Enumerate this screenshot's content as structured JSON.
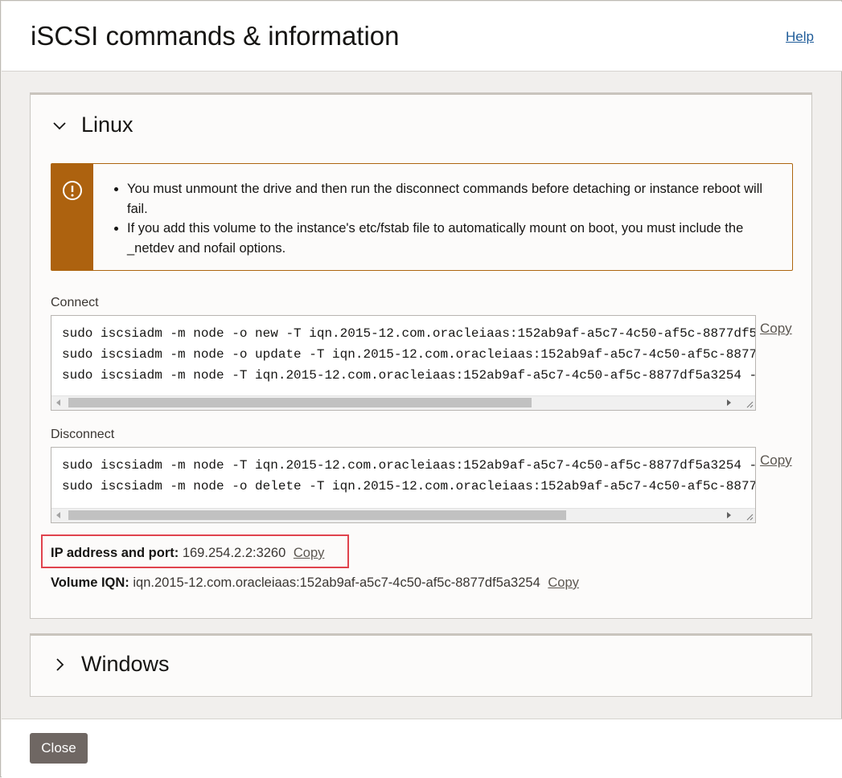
{
  "dialog": {
    "title": "iSCSI commands & information",
    "help_label": "Help"
  },
  "linux": {
    "section_title": "Linux",
    "warning_items": [
      "You must unmount the drive and then run the disconnect commands before detaching or instance reboot will fail.",
      "If you add this volume to the instance's etc/fstab file to automatically mount on boot, you must include the _netdev and nofail options."
    ],
    "connect_label": "Connect",
    "connect_commands": [
      "sudo iscsiadm -m node -o new -T iqn.2015-12.com.oracleiaas:152ab9af-a5c7-4c50-af5c-8877df5",
      "sudo iscsiadm -m node -o update -T iqn.2015-12.com.oracleiaas:152ab9af-a5c7-4c50-af5c-8877",
      "sudo iscsiadm -m node -T iqn.2015-12.com.oracleiaas:152ab9af-a5c7-4c50-af5c-8877df5a3254 -"
    ],
    "disconnect_label": "Disconnect",
    "disconnect_commands": [
      "sudo iscsiadm -m node -T iqn.2015-12.com.oracleiaas:152ab9af-a5c7-4c50-af5c-8877df5a3254 -",
      "sudo iscsiadm -m node -o delete -T iqn.2015-12.com.oracleiaas:152ab9af-a5c7-4c50-af5c-8877"
    ],
    "copy_label": "Copy",
    "ip_label": "IP address and port:",
    "ip_value": "169.254.2.2:3260",
    "iqn_label": "Volume IQN:",
    "iqn_value": "iqn.2015-12.com.oracleiaas:152ab9af-a5c7-4c50-af5c-8877df5a3254"
  },
  "windows": {
    "section_title": "Windows"
  },
  "footer": {
    "close_label": "Close"
  },
  "icons": {
    "warning": "exclamation-circle-icon",
    "expanded": "chevron-down-icon",
    "collapsed": "chevron-right-icon"
  },
  "colors": {
    "warning": "#ad620f",
    "highlight": "#e0434d",
    "link": "#1f5c99",
    "button": "#6f6763"
  }
}
